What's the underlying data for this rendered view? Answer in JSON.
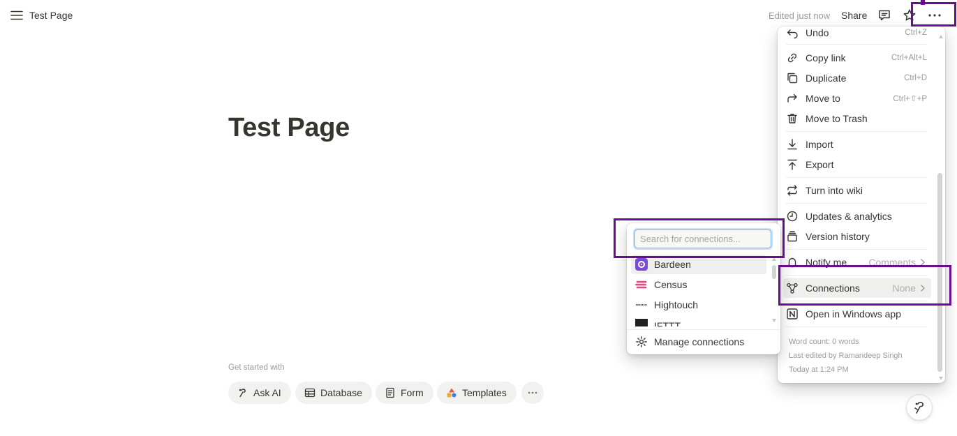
{
  "topbar": {
    "page_name": "Test Page",
    "edited": "Edited just now",
    "share": "Share"
  },
  "page": {
    "title": "Test Page",
    "get_started": "Get started with",
    "chips": [
      {
        "label": "Ask AI",
        "icon": "ai-icon"
      },
      {
        "label": "Database",
        "icon": "table-icon"
      },
      {
        "label": "Form",
        "icon": "form-icon"
      },
      {
        "label": "Templates",
        "icon": "templates-icon"
      }
    ]
  },
  "menu": {
    "items": {
      "undo": {
        "label": "Undo",
        "shortcut": "Ctrl+Z"
      },
      "copy_link": {
        "label": "Copy link",
        "shortcut": "Ctrl+Alt+L"
      },
      "duplicate": {
        "label": "Duplicate",
        "shortcut": "Ctrl+D"
      },
      "move_to": {
        "label": "Move to",
        "shortcut": "Ctrl+⇧+P"
      },
      "trash": {
        "label": "Move to Trash"
      },
      "import": {
        "label": "Import"
      },
      "export": {
        "label": "Export"
      },
      "wiki": {
        "label": "Turn into wiki"
      },
      "updates": {
        "label": "Updates & analytics"
      },
      "version": {
        "label": "Version history"
      },
      "notify": {
        "label": "Notify me",
        "value": "Comments"
      },
      "connections": {
        "label": "Connections",
        "value": "None"
      },
      "windows_app": {
        "label": "Open in Windows app"
      }
    },
    "footer": {
      "word_count": "Word count: 0 words",
      "last_edited": "Last edited by Ramandeep Singh",
      "edited_time": "Today at 1:24 PM"
    }
  },
  "connections_popup": {
    "search_placeholder": "Search for connections...",
    "items": [
      {
        "label": "Bardeen",
        "color": "#7a4bd6"
      },
      {
        "label": "Census",
        "color": "#f0447c"
      },
      {
        "label": "Hightouch",
        "color": "#444444"
      },
      {
        "label": "IFTTT",
        "color": "#222222"
      }
    ],
    "manage": "Manage connections"
  },
  "colors": {
    "highlight": "#6a0d91",
    "text": "#37352f",
    "muted": "#9b9a97"
  }
}
